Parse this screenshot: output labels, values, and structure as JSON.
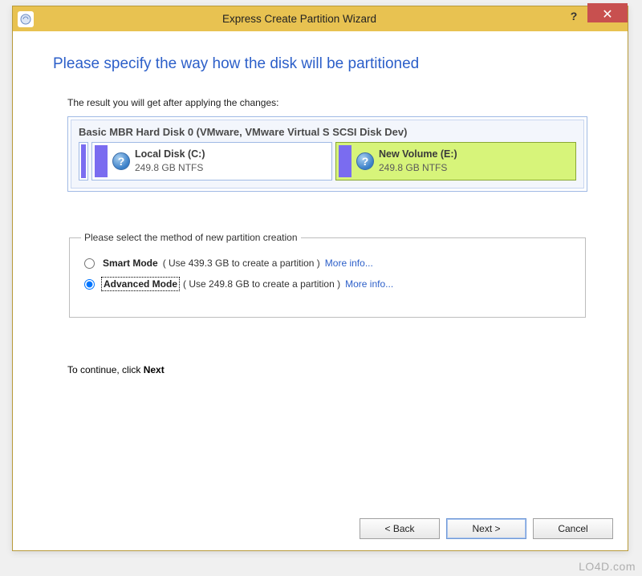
{
  "titlebar": {
    "title": "Express Create Partition Wizard",
    "help_symbol": "?",
    "close_symbol": "✕"
  },
  "heading": "Please specify the way how the disk will be partitioned",
  "result_label": "The result you will get after applying the changes:",
  "disk": {
    "title": "Basic MBR Hard Disk 0 (VMware, VMware Virtual S SCSI Disk Dev)",
    "partitions": [
      {
        "name": "Local Disk (C:)",
        "size": "249.8 GB NTFS",
        "selected": false
      },
      {
        "name": "New Volume (E:)",
        "size": "249.8 GB NTFS",
        "selected": true
      }
    ]
  },
  "method_group": {
    "legend": "Please select the method of new partition creation",
    "options": [
      {
        "id": "smart",
        "label": "Smart Mode",
        "desc": "( Use 439.3 GB to create a partition )",
        "link": "More info...",
        "checked": false
      },
      {
        "id": "advanced",
        "label": "Advanced Mode",
        "desc": "( Use 249.8 GB to create a partition )",
        "link": "More info...",
        "checked": true
      }
    ]
  },
  "continue": {
    "prefix": "To continue, click ",
    "keyword": "Next"
  },
  "buttons": {
    "back": "< Back",
    "next": "Next >",
    "cancel": "Cancel"
  },
  "watermark": "LO4D.com"
}
